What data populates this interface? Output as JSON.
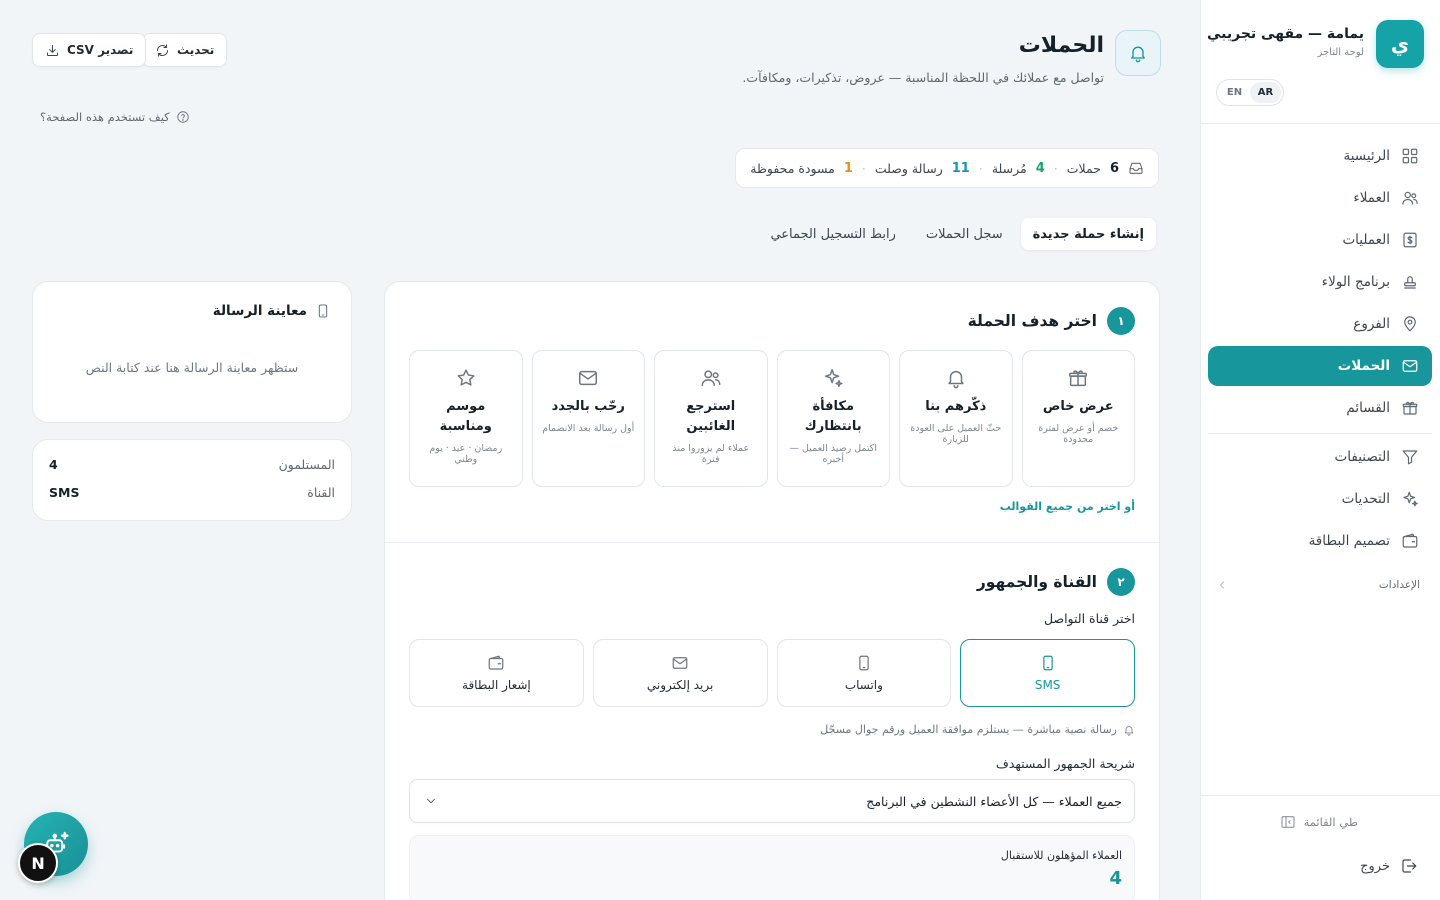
{
  "brand": {
    "avatar_letter": "ي",
    "name": "يمامة — مقهى تجريبي",
    "subtitle": "لوحة التاجر"
  },
  "language": {
    "ar": "AR",
    "en": "EN",
    "selected": "AR"
  },
  "nav": {
    "items": [
      {
        "label": "الرئيسية",
        "icon": "grid-icon"
      },
      {
        "label": "العملاء",
        "icon": "users-icon"
      },
      {
        "label": "العمليات",
        "icon": "receipt-icon"
      },
      {
        "label": "برنامج الولاء",
        "icon": "stamp-icon"
      },
      {
        "label": "الفروع",
        "icon": "map-pin-icon"
      },
      {
        "label": "الحملات",
        "icon": "mail-icon",
        "active": true
      },
      {
        "label": "القسائم",
        "icon": "gift-icon"
      },
      {
        "label": "التصنيفات",
        "icon": "filter-icon"
      },
      {
        "label": "التحديات",
        "icon": "sparkle-icon"
      },
      {
        "label": "تصميم البطاقة",
        "icon": "wallet-icon"
      }
    ],
    "settings_label": "الإعدادات",
    "collapse_label": "طي القائمة",
    "logout_label": "خروج"
  },
  "header": {
    "title": "الحملات",
    "subtitle": "تواصل مع عملائك في اللحظة المناسبة — عروض، تذكيرات، ومكافآت.",
    "refresh_label": "تحديث",
    "export_label": "تصدير CSV",
    "help_label": "كيف تستخدم هذه الصفحة؟"
  },
  "stats": {
    "campaigns_count": "6",
    "campaigns_label": "حملات",
    "sent_count": "4",
    "sent_label": "مُرسلة",
    "delivered_count": "11",
    "delivered_label": "رسالة وصلت",
    "drafts_count": "1",
    "drafts_label": "مسودة محفوظة",
    "separator": "·"
  },
  "tabs": [
    {
      "label": "إنشاء حملة جديدة",
      "active": true
    },
    {
      "label": "سجل الحملات"
    },
    {
      "label": "رابط التسجيل الجماعي"
    }
  ],
  "step1": {
    "number": "١",
    "title": "اختر هدف الحملة",
    "goals": [
      {
        "title": "عرض خاص",
        "desc": "خصم أو عرض لفترة محدودة",
        "icon": "gift-icon"
      },
      {
        "title": "ذكّرهم بنا",
        "desc": "حثّ العميل على العودة للزيارة",
        "icon": "bell-icon"
      },
      {
        "title": "مكافأة بانتظارك",
        "desc": "اكتمل رصيد العميل — أخبره",
        "icon": "sparkle-icon"
      },
      {
        "title": "استرجع الغائبين",
        "desc": "عملاء لم يزوروا منذ فترة",
        "icon": "users-icon"
      },
      {
        "title": "رحّب بالجدد",
        "desc": "أول رسالة بعد الانضمام",
        "icon": "mail-icon"
      },
      {
        "title": "موسم ومناسبة",
        "desc": "رمضان · عيد · يوم وطني",
        "icon": "star-icon"
      }
    ],
    "all_templates_link": "أو اختر من جميع القوالب"
  },
  "step2": {
    "number": "٢",
    "title": "القناة والجمهور",
    "channel_label": "اختر قناة التواصل",
    "channels": [
      {
        "label": "SMS",
        "icon": "phone-icon",
        "active": true
      },
      {
        "label": "واتساب",
        "icon": "phone-icon"
      },
      {
        "label": "بريد إلكتروني",
        "icon": "mail-icon"
      },
      {
        "label": "إشعار البطاقة",
        "icon": "wallet-icon"
      }
    ],
    "channel_note": "رسالة نصية مباشرة — يستلزم موافقة العميل ورقم جوال مسجّل",
    "audience_label": "شريحة الجمهور المستهدف",
    "audience_value": "جميع العملاء — كل الأعضاء النشطين في البرنامج",
    "eligible_label": "العملاء المؤهلون للاستقبال",
    "eligible_value": "4"
  },
  "preview": {
    "title": "معاينة الرسالة",
    "empty_text": "ستظهر معاينة الرسالة هنا عند كتابة النص"
  },
  "summary": {
    "recipients_label": "المستلمون",
    "recipients_value": "4",
    "channel_label": "القناة",
    "channel_value": "SMS"
  },
  "floating": {
    "n_badge": "N"
  },
  "colors": {
    "accent": "#17979c",
    "stat_green": "#1aa569",
    "stat_teal": "#1a94b8",
    "stat_orange": "#e48f1d"
  }
}
